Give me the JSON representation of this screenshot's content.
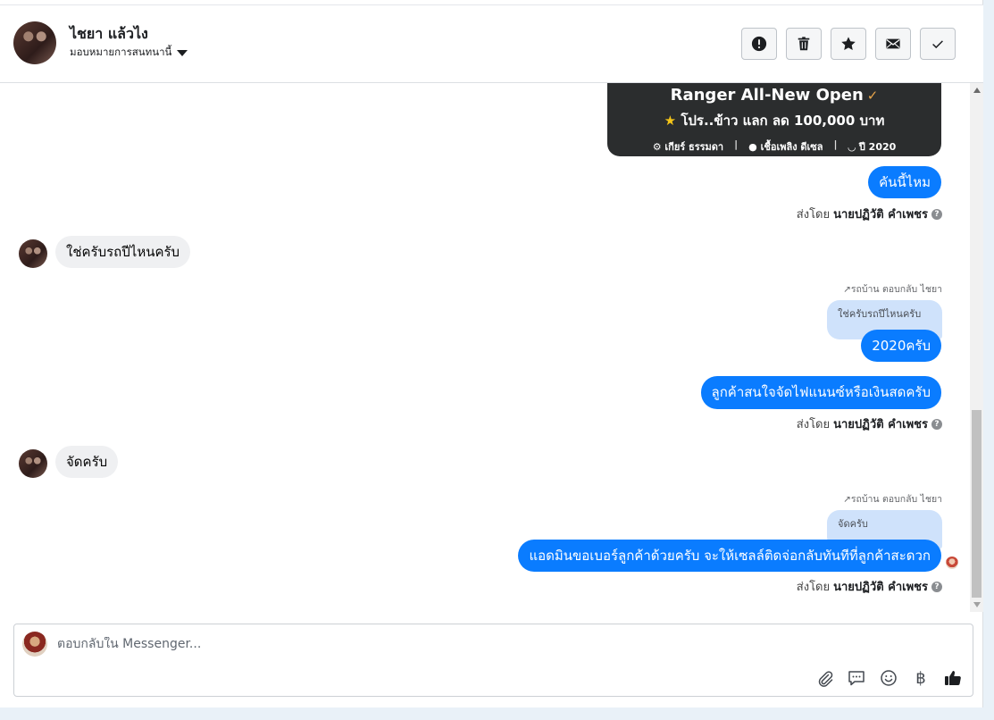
{
  "header": {
    "contact_name": "ไชยา แล้วไง",
    "assign_label": "มอบหมายการสนทนานี้",
    "actions": [
      {
        "icon": "alert-icon"
      },
      {
        "icon": "trash-icon"
      },
      {
        "icon": "star-icon"
      },
      {
        "icon": "envelope-icon"
      },
      {
        "icon": "check-icon"
      }
    ]
  },
  "card": {
    "title": "Ranger All-New Open",
    "promo": "โปร..ข้าว แลก ลด 100,000 บาท",
    "spec_gear": "เกียร์ ธรรมดา",
    "spec_fuel": "เชื้อเพลิง ดีเซล",
    "spec_year": "ปี 2020"
  },
  "messages": {
    "m1": "คันนี้ไหม",
    "m1_sent_prefix": "ส่งโดย",
    "m1_sent_name": "นายปฏิวัติ คำเพชร",
    "m2": "ใช่ครับรถปีไหนครับ",
    "m3_meta": "รถบ้าน ตอบกลับ ไชยา",
    "m3_quote": "ใช่ครับรถปีไหนครับ",
    "m3": "2020ครับ",
    "m4": "ลูกค้าสนใจจัดไฟแนนซ์หรือเงินสดครับ",
    "m4_sent_prefix": "ส่งโดย",
    "m4_sent_name": "นายปฏิวัติ คำเพชร",
    "m5": "จัดครับ",
    "m6_meta": "รถบ้าน ตอบกลับ ไชยา",
    "m6_quote": "จัดครับ",
    "m6": "แอดมินขอเบอร์ลูกค้าด้วยครับ จะให้เซลล์ติดจ่อกลับทันทีที่ลูกค้าสะดวก",
    "m6_sent_prefix": "ส่งโดย",
    "m6_sent_name": "นายปฏิวัติ คำเพชร"
  },
  "composer": {
    "placeholder": "ตอบกลับใน Messenger...",
    "tools": [
      "paperclip-icon",
      "chat-bubble-icon",
      "emoji-icon",
      "baht-icon",
      "thumbs-up-icon"
    ],
    "baht_symbol": "฿"
  },
  "colors": {
    "outgoing_bubble": "#0a7cff",
    "incoming_bubble": "#eff0f2",
    "quoted_bubble": "#cfe2fb",
    "card_bg": "#2b2d2e"
  }
}
